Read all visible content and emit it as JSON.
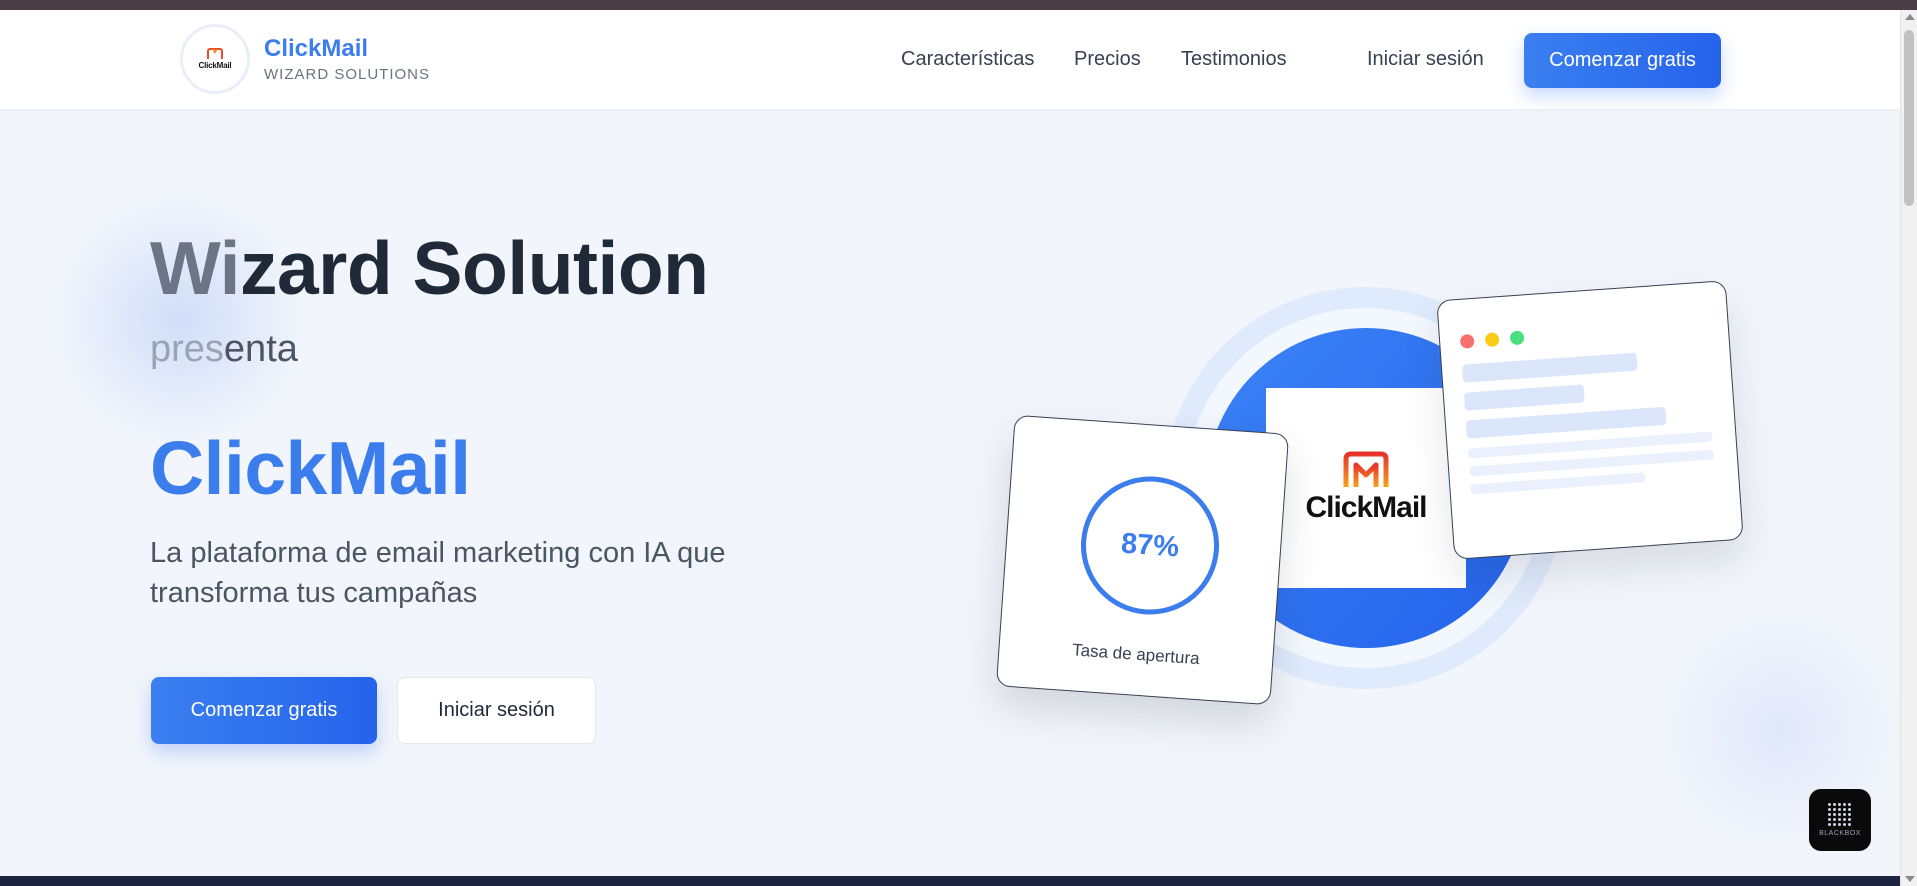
{
  "brand": {
    "name": "ClickMail",
    "subtitle": "WIZARD SOLUTIONS",
    "logo_text": "ClickMail"
  },
  "nav": {
    "features": "Características",
    "prices": "Precios",
    "testimonials": "Testimonios",
    "login": "Iniciar sesión",
    "cta": "Comenzar gratis"
  },
  "hero": {
    "title_fade": "Wi",
    "title_rest": "zard Solution",
    "presenta_fade": "pres",
    "presenta_rest": "enta",
    "product": "ClickMail",
    "tagline": "La plataforma de email marketing con IA que transforma tus campañas",
    "cta_primary": "Comenzar gratis",
    "cta_secondary": "Iniciar sesión"
  },
  "illustration": {
    "logo_word": "ClickMail",
    "stat_value": "87%",
    "stat_label": "Tasa de apertura"
  },
  "widget": {
    "label": "BLACKBOX",
    "icon": "blackbox-icon"
  },
  "colors": {
    "accent": "#3b7ded",
    "primary_button": "#2563eb",
    "hero_background": "#f2f5fb",
    "title_text": "#1f2937"
  }
}
